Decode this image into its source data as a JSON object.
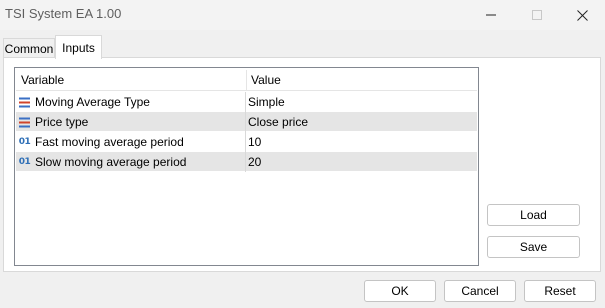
{
  "window": {
    "title": "TSI System EA 1.00"
  },
  "tabs": [
    {
      "label": "Common",
      "active": false
    },
    {
      "label": "Inputs",
      "active": true
    }
  ],
  "grid": {
    "columns": [
      "Variable",
      "Value"
    ],
    "rows": [
      {
        "icon": "enum-list-icon",
        "variable": "Moving Average Type",
        "value": "Simple"
      },
      {
        "icon": "enum-list-icon",
        "variable": "Price type",
        "value": "Close price"
      },
      {
        "icon": "integer-icon",
        "icon_text": "01",
        "variable": "Fast moving average period",
        "value": "10"
      },
      {
        "icon": "integer-icon",
        "icon_text": "01",
        "variable": "Slow moving average period",
        "value": "20"
      }
    ]
  },
  "side_buttons": {
    "load": "Load",
    "save": "Save"
  },
  "footer_buttons": {
    "ok": "OK",
    "cancel": "Cancel",
    "reset": "Reset"
  },
  "colors": {
    "window_bg": "#f0f0f0",
    "panel_bg": "#ffffff",
    "alt_row": "#e5e5e5",
    "enum_icon_blue": "#3a6fc4",
    "enum_icon_red": "#d0442c",
    "integer_icon": "#2f6fb6"
  }
}
